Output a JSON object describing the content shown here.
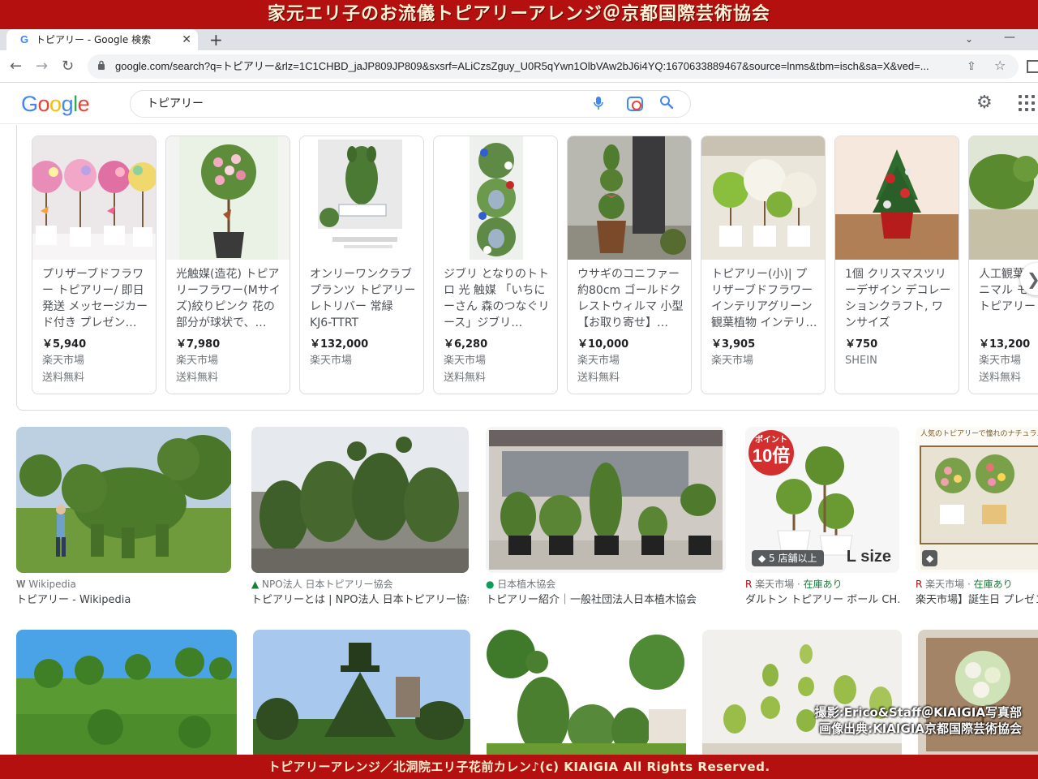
{
  "banner": {
    "top": "家元エリ子のお流儀トピアリーアレンジ＠京都国際芸術協会",
    "bottom": "トピアリーアレンジ／北洞院エリ子花前カレン♪(c) KIAIGIA All Rights Reserved."
  },
  "browser": {
    "tab_title": "トピアリー - Google 検索",
    "favicon": "G",
    "url": "google.com/search?q=トピアリー&rlz=1C1CHBD_jaJP809JP809&sxsrf=ALiCzsZguy_U0R5qYwn1OlbVAw2bJ6i4YQ:1670633889467&source=lnms&tbm=isch&sa=X&ved=..."
  },
  "google": {
    "logo_letters": [
      "G",
      "o",
      "o",
      "g",
      "l",
      "e"
    ],
    "query": "トピアリー"
  },
  "shopping": [
    {
      "title": "プリザーブドフラワー トピアリー/ 即日発送 メッセージカード付き プレゼン…",
      "price": "￥5,940",
      "store": "楽天市場",
      "shipping": "送料無料"
    },
    {
      "title": "光触媒(造花) トピアリーフラワー(Mサイズ)絞りピンク 花の部分が球状で、…",
      "price": "￥7,980",
      "store": "楽天市場",
      "shipping": "送料無料"
    },
    {
      "title": "オンリーワンクラブ プランツ トピアリー レトリバー 常緑 KJ6-TTRT",
      "price": "￥132,000",
      "store": "楽天市場",
      "shipping": ""
    },
    {
      "title": "ジブリ となりのトトロ 光 触媒 「いちにーさん 森のつなぐリース」ジブリ…",
      "price": "￥6,280",
      "store": "楽天市場",
      "shipping": "送料無料"
    },
    {
      "title": "ウサギのコニファー 約80cm ゴールドクレストウィルマ 小型 【お取り寄せ】…",
      "price": "￥10,000",
      "store": "楽天市場",
      "shipping": "送料無料"
    },
    {
      "title": "トピアリー(小)| プリザーブドフラワー インテリアグリーン 観葉植物 インテリ…",
      "price": "￥3,905",
      "store": "楽天市場",
      "shipping": ""
    },
    {
      "title": "1個 クリスマスツリーデザイン デコレーションクラフト, ワンサイズ",
      "price": "￥750",
      "store": "SHEIN",
      "shipping": ""
    },
    {
      "title": "人工観葉植物 型 アニマル モチーフ カ トピアリー",
      "price": "￥13,200",
      "store": "楽天市場",
      "shipping": "送料無料"
    }
  ],
  "results": [
    {
      "source": "Wikipedia",
      "title": "トピアリー - Wikipedia",
      "availability": ""
    },
    {
      "source": "NPO法人 日本トピアリー協会",
      "title": "トピアリーとは | NPO法人 日本トピアリー協会",
      "availability": ""
    },
    {
      "source": "日本植木協会",
      "title": "トピアリー紹介｜一般社団法人日本植木協会",
      "availability": ""
    },
    {
      "source": "楽天市場 · ",
      "title": "ダルトン トピアリー ボール CH…",
      "availability": "在庫あり",
      "badge": "5 店舗以上",
      "points_label": "ポイント",
      "points_value": "10倍",
      "size_text": "L size"
    },
    {
      "source": "楽天市場 · ",
      "title": "楽天市場】誕生日 プレゼント",
      "availability": "在庫あり",
      "overlay_text": "人気のトピアリーで憧れのナチュラル…"
    }
  ],
  "watermark": {
    "line1": "撮影:Erico&Staff＠KIAIGIA写真部",
    "line2": "画像出典:KIAIGIA京都国際芸術協会"
  },
  "icons": {
    "close": "✕",
    "new_tab": "+",
    "back": "←",
    "forward": "→",
    "reload": "↻",
    "lock": "🔒",
    "share": "⇪",
    "star": "☆",
    "mic": "🎤",
    "search": "🔍",
    "gear": "⚙",
    "next": "❯",
    "chevron": "⌄",
    "minimize": "—"
  }
}
